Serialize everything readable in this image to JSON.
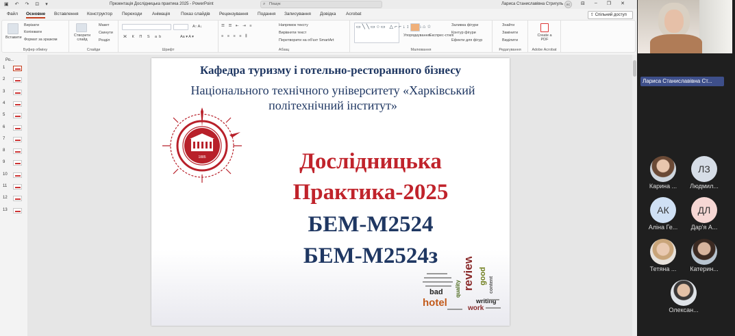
{
  "titlebar": {
    "doc_title": "Презентація Дослідницька практика 2025  -  PowerPoint",
    "search_placeholder": "Пошук",
    "user_name": "Лариса Станиславівна Стригуль",
    "user_initials": "ЛС"
  },
  "tabs": [
    "Файл",
    "Основне",
    "Вставлення",
    "Конструктор",
    "Переходи",
    "Анімація",
    "Показ слайдів",
    "Рецензування",
    "Подання",
    "Записування",
    "Довідка",
    "Acrobat"
  ],
  "active_tab": "Основне",
  "share_label": "Спільний доступ",
  "ribbon": {
    "clipboard": {
      "paste": "Вставити",
      "cut": "Вирізати",
      "copy": "Копіювати",
      "format": "Формат за зразком",
      "caption": "Буфер обміну"
    },
    "slides": {
      "new": "Створити слайд",
      "layout": "Макет",
      "reset": "Скинути",
      "section": "Розділ",
      "caption": "Слайди"
    },
    "font": {
      "caption": "Шрифт"
    },
    "paragraph": {
      "direction": "Напрямок тексту",
      "align": "Вирівняти текст",
      "smartart": "Перетворити на об'єкт SmartArt",
      "caption": "Абзац"
    },
    "drawing": {
      "arrange": "Упорядкування",
      "styles": "Експрес-стилі",
      "fill": "Заливка фігури",
      "outline": "Контур фігури",
      "effects": "Ефекти для фігур",
      "caption": "Малювання"
    },
    "editing": {
      "find": "Знайти",
      "replace": "Замінити",
      "select": "Виділити",
      "caption": "Редагування"
    },
    "acrobat": {
      "create": "Create a PDF",
      "caption": "Adobe Acrobat"
    }
  },
  "thumbnails": {
    "header": "Ро...",
    "numbers": [
      "1",
      "2",
      "3",
      "4",
      "5",
      "6",
      "7",
      "8",
      "9",
      "10",
      "11",
      "12",
      "13"
    ],
    "selected": "1"
  },
  "slide": {
    "dept": "Кафедра  туризму і готельно-ресторанного бізнесу",
    "uni_line1": "Національного технічного університету «Харківський",
    "uni_line2": "політехнічний інститут»",
    "title1": "Дослідницька",
    "title2": "Практика-2025",
    "group1": "БЕМ-М2524",
    "group2": "БЕМ-М2524з",
    "emblem_year": "1885",
    "cloud_words": [
      "review",
      "hotel",
      "bad",
      "good",
      "quality",
      "writing",
      "work",
      "content"
    ]
  },
  "teams": {
    "presenter_chip": "Лариса Станиславівна Ст...",
    "participants": [
      {
        "name": "Карина ...",
        "initials": ""
      },
      {
        "name": "Людмил...",
        "initials": "ЛЗ"
      },
      {
        "name": "Аліна Ге...",
        "initials": "АК"
      },
      {
        "name": "Дар'я А...",
        "initials": "ДЛ"
      },
      {
        "name": "Тетяна ...",
        "initials": ""
      },
      {
        "name": "Катерин...",
        "initials": ""
      },
      {
        "name": "Олексан...",
        "initials": ""
      }
    ]
  }
}
